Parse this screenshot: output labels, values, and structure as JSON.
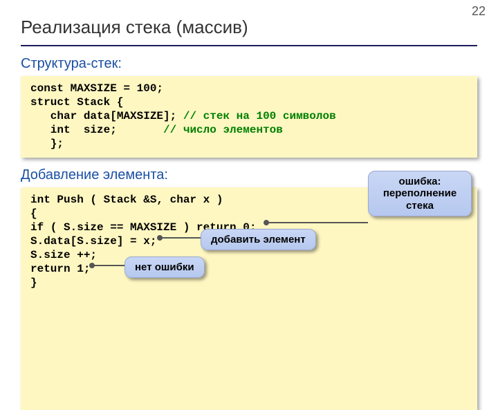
{
  "page_number": "22",
  "title": "Реализация стека (массив)",
  "section1_label": "Структура-стек:",
  "section2_label": "Добавление элемента:",
  "code1": {
    "l1": "const MAXSIZE = 100;",
    "l2": "struct Stack {",
    "l3a": "   char data[MAXSIZE]; ",
    "l3c": "// стек на 100 символов",
    "l4a": "   int  size;       ",
    "l4c": "// число элементов",
    "l5": "   };"
  },
  "code2": {
    "l1": "int Push ( Stack &S, char x )",
    "l2": "{",
    "l3": "if ( S.size == MAXSIZE ) return 0;",
    "l4": "S.data[S.size] = x;",
    "l5": "S.size ++;",
    "l6": "return 1;",
    "l7": "}"
  },
  "callouts": {
    "overflow": "ошибка: переполнение стека",
    "add": "добавить элемент",
    "noerror": "нет ошибки"
  }
}
